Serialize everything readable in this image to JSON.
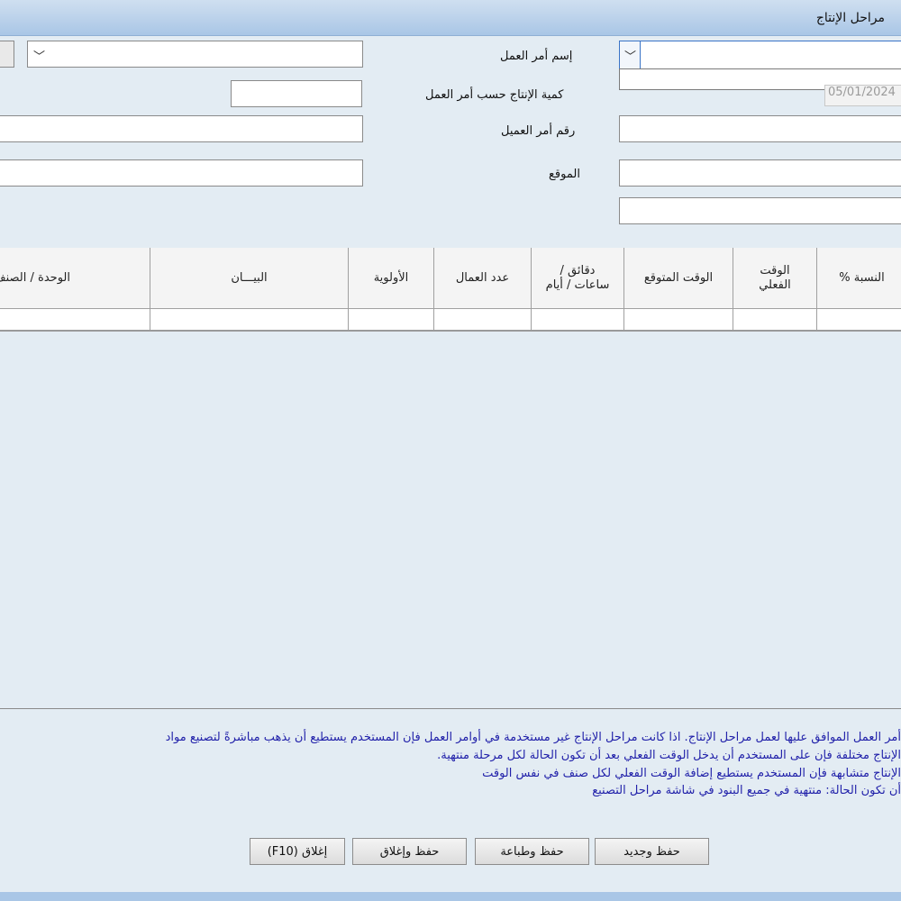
{
  "window": {
    "title": "مراحل الإنتاج"
  },
  "form": {
    "work_order_name_label": "إسم أمر العمل",
    "work_order_name_value": "",
    "production_qty_label": "كمية الإنتاج حسب أمر العمل",
    "production_qty_value": "",
    "customer_order_label": "رقم أمر العميل",
    "customer_order_value": "",
    "location_label": "الموقع",
    "location_value": "",
    "date_value": "05/01/2024"
  },
  "icons": {
    "chevron": "chevron-down-icon"
  },
  "table": {
    "headers": [
      "% النسبة",
      "الوقت الفعلي",
      "الوقت المتوقع",
      "دقائق / ساعات / أيام",
      "عدد العمال",
      "الأولوية",
      "البيـــان",
      "الوحدة / الصنف"
    ]
  },
  "notes": [
    "أمر العمل الموافق عليها لعمل مراحل الإنتاج. اذا كانت مراحل الإنتاج غير مستخدمة في أوامر العمل فإن المستخدم يستطيع أن يذهب مباشرةً لتصنيع مواد",
    "الإنتاج مختلفة فإن على المستخدم أن يدخل الوقت الفعلي بعد أن تكون الحالة لكل مرحلة منتهية.",
    "الإنتاج متشابهة فإن المستخدم يستطيع إضافة الوقت الفعلي لكل صنف في نفس الوقت",
    "أن تكون الحالة: منتهية في جميع البنود في شاشة مراحل التصنيع"
  ],
  "buttons": {
    "save_new": "حفظ وجديد",
    "save_print": "حفظ وطباعة",
    "save_close": "حفظ وإغلاق",
    "close": "(F10) إغلاق"
  }
}
